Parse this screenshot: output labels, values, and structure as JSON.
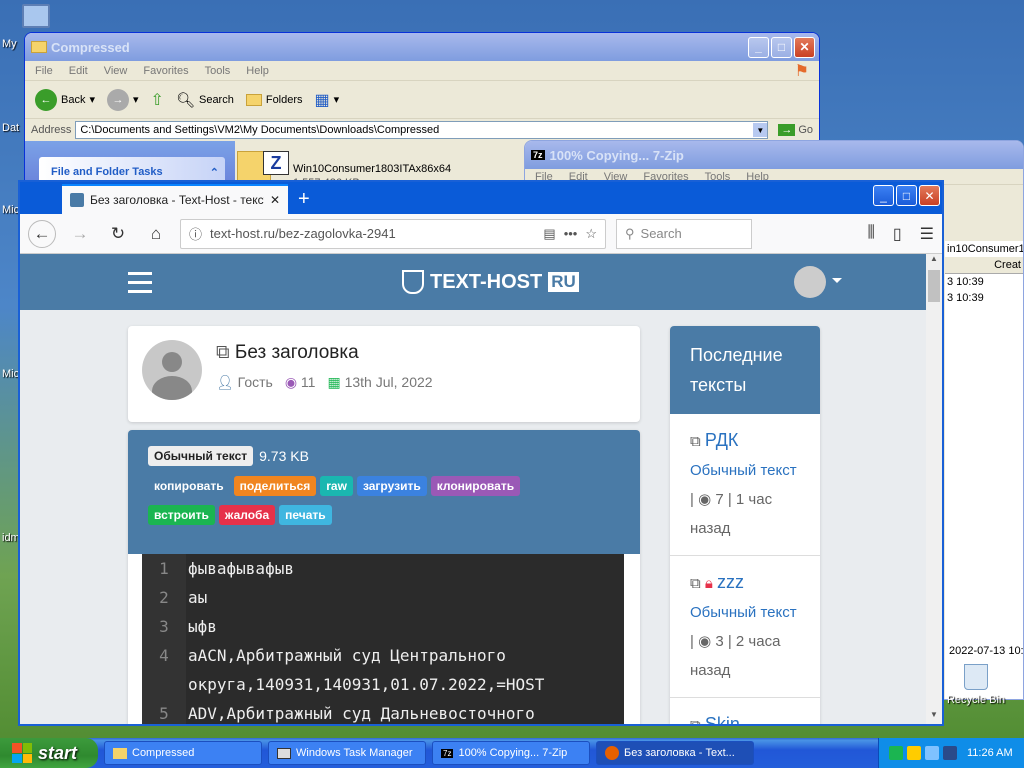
{
  "desktop": {
    "icons": [
      {
        "label": "My"
      },
      {
        "label": "Dat"
      },
      {
        "label": "Mic"
      },
      {
        "label": "Mic"
      },
      {
        "label": "idm"
      }
    ],
    "recycle_label": "Recycle Bin"
  },
  "explorer": {
    "title": "Compressed",
    "menu": [
      "File",
      "Edit",
      "View",
      "Favorites",
      "Tools",
      "Help"
    ],
    "toolbar": {
      "back": "Back",
      "search": "Search",
      "folders": "Folders"
    },
    "address_label": "Address",
    "address": "C:\\Documents and Settings\\VM2\\My Documents\\Downloads\\Compressed",
    "go": "Go",
    "tasks_title": "File and Folder Tasks",
    "file_name": "Win10Consumer1803ITAx86x64",
    "file_size": "1 557 426 KB"
  },
  "zip": {
    "title": "100% Copying... 7-Zip",
    "menu": [
      "File",
      "Edit",
      "View",
      "Favorites",
      "Tools",
      "Help"
    ],
    "side_filename": "in10Consumer18",
    "side_header": "Creat",
    "rows": [
      "3 10:39",
      "3 10:39"
    ],
    "bottom_date": "2022-07-13 10:"
  },
  "firefox": {
    "tab_title": "Без заголовка - Text-Host - текст",
    "url": "text-host.ru/bez-zagolovka-2941",
    "search_placeholder": "Search"
  },
  "site": {
    "logo_text": "TEXT-HOST",
    "logo_ru": "RU",
    "page_title": "Без заголовка",
    "author": "Гость",
    "views": "11",
    "date": "13th Jul, 2022",
    "badge": "Обычный текст",
    "size": "9.73 KB",
    "buttons_row1": [
      {
        "label": "копировать",
        "color": "#4a7ba6"
      },
      {
        "label": "поделиться",
        "color": "#f0851f"
      },
      {
        "label": "raw",
        "color": "#1ab7b0"
      },
      {
        "label": "загрузить",
        "color": "#3b82e0"
      },
      {
        "label": "клонировать",
        "color": "#9a59b6"
      }
    ],
    "buttons_row2": [
      {
        "label": "встроить",
        "color": "#1bb551"
      },
      {
        "label": "жалоба",
        "color": "#e6314a"
      },
      {
        "label": "печать",
        "color": "#3fb6e0"
      }
    ],
    "code_lines": [
      {
        "n": "1",
        "t": "фывафывафыв"
      },
      {
        "n": "2",
        "t": "аы"
      },
      {
        "n": "3",
        "t": "ыфв"
      },
      {
        "n": "4",
        "t": "aACN,Арбитражный суд Центрального"
      },
      {
        "n": "",
        "t": "округа,140931,140931,01.07.2022,=HOST"
      },
      {
        "n": "5",
        "t": "ADV,Арбитражный суд Дальневосточного"
      }
    ],
    "sidebar_title": "Последние тексты",
    "sidebar_items": [
      {
        "name": "РДК",
        "type": "Обычный текст",
        "views": "7",
        "age": "1 час назад",
        "locked": false
      },
      {
        "name": "zzz",
        "type": "Обычный текст",
        "views": "3",
        "age": "2 часа назад",
        "locked": true
      },
      {
        "name": "Skin",
        "type": "",
        "views": "",
        "age": "",
        "locked": false
      }
    ]
  },
  "taskbar": {
    "start": "start",
    "tasks": [
      {
        "label": "Compressed"
      },
      {
        "label": "Windows Task Manager"
      },
      {
        "label": "100% Copying... 7-Zip"
      },
      {
        "label": "Без заголовка - Text..."
      }
    ],
    "clock": "11:26 AM"
  }
}
